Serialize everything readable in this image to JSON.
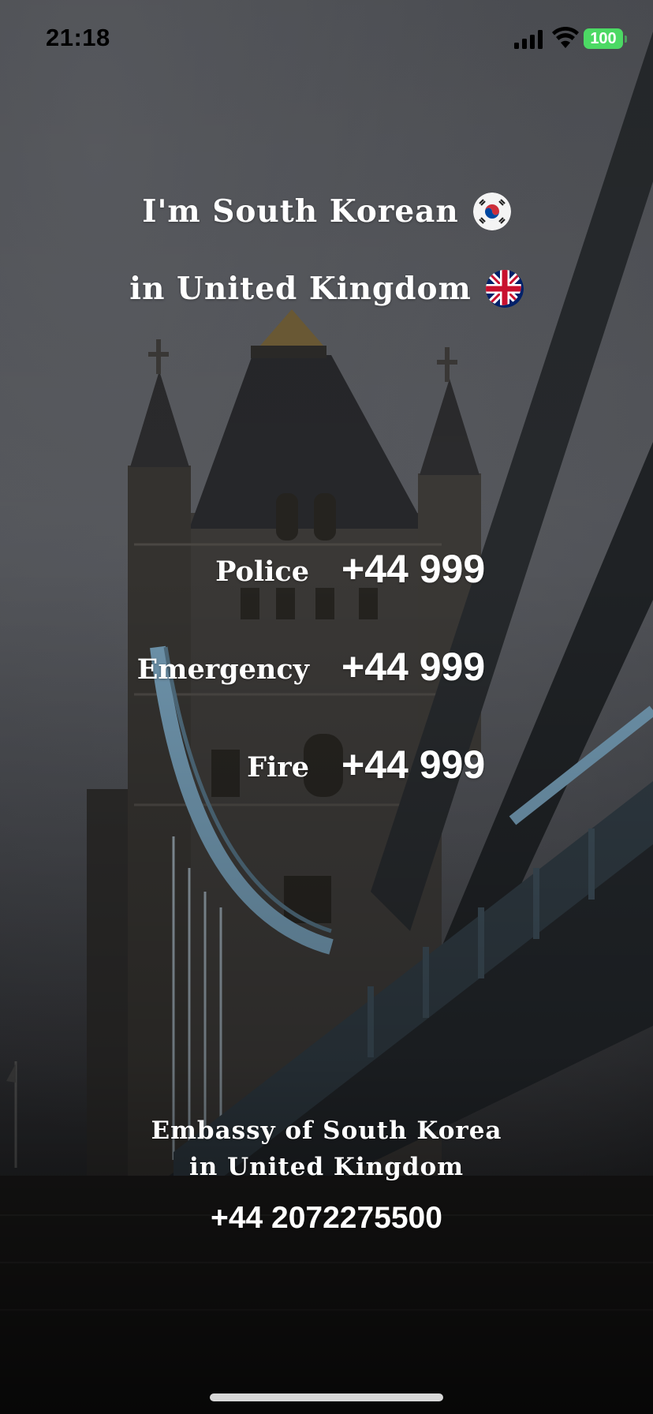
{
  "status_bar": {
    "time": "21:18",
    "battery": "100",
    "battery_color": "#4cd964"
  },
  "header": {
    "nationality_line": "I'm South Korean",
    "location_line": "in United Kingdom",
    "home_flag_icon": "south-korea-flag-icon",
    "host_flag_icon": "united-kingdom-flag-icon"
  },
  "emergency_numbers": [
    {
      "label": "Police",
      "number": "+44 999"
    },
    {
      "label": "Emergency",
      "number": "+44 999"
    },
    {
      "label": "Fire",
      "number": "+44 999"
    }
  ],
  "embassy": {
    "name_line1": "Embassy of South Korea",
    "name_line2": "in United Kingdom",
    "phone": "+44 2072275500"
  },
  "background": {
    "icon": "tower-bridge-photo",
    "accent_blue": "#6f95ad"
  }
}
